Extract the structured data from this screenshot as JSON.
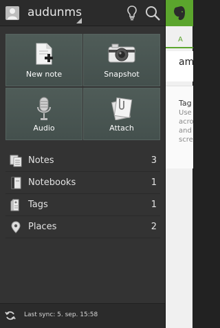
{
  "account": {
    "username": "audunms"
  },
  "tiles": [
    {
      "label": "New note",
      "icon": "new-note-icon"
    },
    {
      "label": "Snapshot",
      "icon": "camera-icon"
    },
    {
      "label": "Audio",
      "icon": "microphone-icon"
    },
    {
      "label": "Attach",
      "icon": "paperclip-icon"
    }
  ],
  "nav": [
    {
      "label": "Notes",
      "count": "3",
      "icon": "notes-icon"
    },
    {
      "label": "Notebooks",
      "count": "1",
      "icon": "notebook-icon"
    },
    {
      "label": "Tags",
      "count": "1",
      "icon": "tag-icon"
    },
    {
      "label": "Places",
      "count": "2",
      "icon": "place-pin-icon"
    }
  ],
  "footer": {
    "sync_text": "Last sync: 5. sep. 15:58"
  },
  "content_peek": {
    "tab_label": "A",
    "card_text": "am",
    "tip_title": "Tag",
    "tip_lines": [
      "Use",
      "acro",
      "and",
      "scre"
    ]
  },
  "colors": {
    "drawer_bg": "#333333",
    "tile_bg": "#4f5c58",
    "evernote_green": "#5ba52d"
  }
}
